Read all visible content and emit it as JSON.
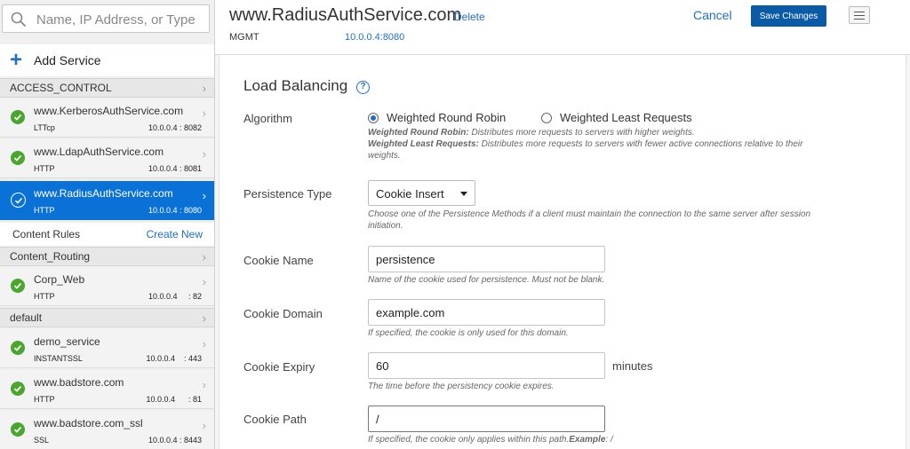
{
  "sidebar": {
    "search_placeholder": "Name, IP Address, or Type",
    "add_service": "Add Service",
    "groups": [
      {
        "label": "ACCESS_CONTROL"
      },
      {
        "label": "Content_Routing"
      },
      {
        "label": "default"
      }
    ],
    "services": [
      {
        "name": "www.KerberosAuthService.com",
        "proto": "LTTcp",
        "addr": "10.0.0.4 : 8082"
      },
      {
        "name": "www.LdapAuthService.com",
        "proto": "HTTP",
        "addr": "10.0.0.4 : 8081"
      },
      {
        "name": "www.RadiusAuthService.com",
        "proto": "HTTP",
        "addr": "10.0.0.4 : 8080"
      },
      {
        "name": "Corp_Web",
        "proto": "HTTP",
        "addr": "10.0.0.4     : 82"
      },
      {
        "name": "demo_service",
        "proto": "INSTANTSSL",
        "addr": "10.0.0.4    : 443"
      },
      {
        "name": "www.badstore.com",
        "proto": "HTTP",
        "addr": "10.0.0.4      : 81"
      },
      {
        "name": "www.badstore.com_ssl",
        "proto": "SSL",
        "addr": "10.0.0.4 : 8443"
      }
    ],
    "content_rules_label": "Content Rules",
    "create_new": "Create New"
  },
  "header": {
    "title": "www.RadiusAuthService.com",
    "delete": "Delete",
    "mgmt_label": "MGMT",
    "mgmt_addr": "10.0.0.4:8080",
    "cancel": "Cancel",
    "save": "Save Changes"
  },
  "lb": {
    "title": "Load Balancing",
    "help": "?",
    "algorithm_label": "Algorithm",
    "algo_opt1": "Weighted Round Robin",
    "algo_opt2": "Weighted Least Requests",
    "algo_hint1_b": "Weighted Round Robin:",
    "algo_hint1": " Distributes more requests to servers with higher weights.",
    "algo_hint2_b": "Weighted Least Requests:",
    "algo_hint2": " Distributes more requests to servers with fewer active connections relative to their weights.",
    "persistence_label": "Persistence Type",
    "persistence_value": "Cookie Insert",
    "persistence_hint": "Choose one of the Persistence Methods if a client must maintain the connection to the same server after session initiation.",
    "cookie_name_label": "Cookie Name",
    "cookie_name_value": "persistence",
    "cookie_name_hint": "Name of the cookie used for persistence. Must not be blank.",
    "cookie_domain_label": "Cookie Domain",
    "cookie_domain_value": "example.com",
    "cookie_domain_hint": "If specified, the cookie is only used for this domain.",
    "cookie_expiry_label": "Cookie Expiry",
    "cookie_expiry_value": "60",
    "cookie_expiry_unit": "minutes",
    "cookie_expiry_hint": "The time before the persistency cookie expires.",
    "cookie_path_label": "Cookie Path",
    "cookie_path_value": "/",
    "cookie_path_hint": "If specified, the cookie only applies within this path.",
    "cookie_path_hint_b": "Example",
    "cookie_path_hint_tail": ": /"
  },
  "colors": {
    "accent": "#1f6fc5",
    "active": "#0a72d6",
    "ok": "#4aa62e",
    "save": "#0a5aa6"
  }
}
